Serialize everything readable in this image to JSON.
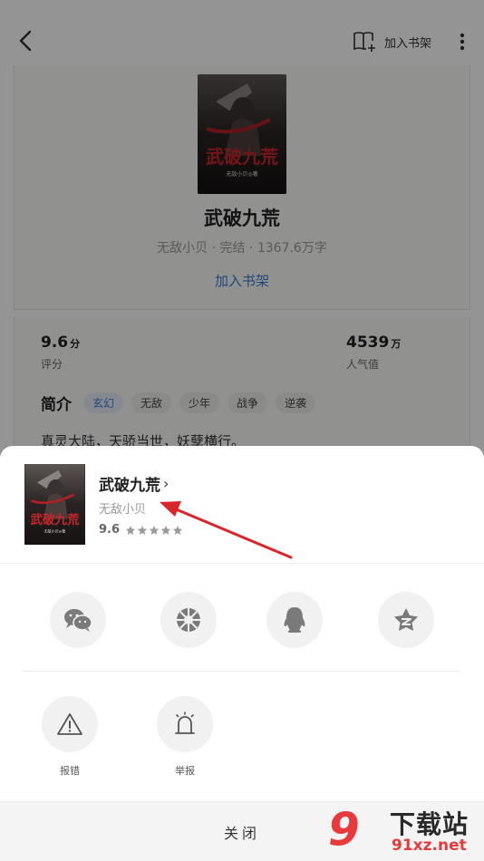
{
  "header": {
    "add_shelf_label": "加入书架",
    "back_icon": "back-arrow-icon",
    "more_icon": "more-vertical-icon"
  },
  "book": {
    "title": "武破九荒",
    "meta": "无敌小贝 · 完结 · 1367.6万字",
    "add_shelf_link": "加入书架",
    "cover_text": "武破九荒",
    "cover_author": "无敌小贝◎著"
  },
  "stats": {
    "score": {
      "value": "9.6",
      "unit": "分",
      "label": "评分"
    },
    "popularity": {
      "value": "4539",
      "unit": "万",
      "label": "人气值"
    }
  },
  "intro": {
    "heading": "简介",
    "tags": [
      "玄幻",
      "无敌",
      "少年",
      "战争",
      "逆袭"
    ],
    "synopsis": "真灵大陆，天骄当世，妖孽横行。"
  },
  "sheet": {
    "title": "武破九荒",
    "chevron": "›",
    "author": "无敌小贝",
    "rating": "9.6",
    "rating_stars": 5,
    "share_targets": [
      {
        "icon": "wechat-icon"
      },
      {
        "icon": "moments-icon"
      },
      {
        "icon": "qq-icon"
      },
      {
        "icon": "qzone-icon"
      }
    ],
    "actions": [
      {
        "icon": "warning-icon",
        "label": "报错"
      },
      {
        "icon": "alarm-icon",
        "label": "举报"
      }
    ],
    "close_label": "关闭"
  },
  "watermark": {
    "logo": "9",
    "text": "下载站",
    "url": "91xz.net"
  },
  "colors": {
    "accent_blue": "#3a7bd5",
    "annotation_red": "#d9262b",
    "watermark_red": "#e8393c"
  }
}
